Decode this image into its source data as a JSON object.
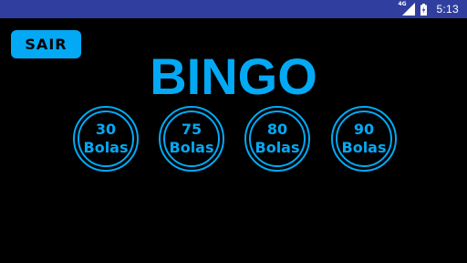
{
  "status_bar": {
    "network": "4G",
    "time": "5:13",
    "icons": [
      "signal-icon",
      "battery-charging-icon"
    ],
    "color": "#303f9f"
  },
  "exit_button": {
    "label": "SAIR",
    "color": "#03a9f4"
  },
  "title": "BINGO",
  "accent_color": "#03a9f4",
  "ball_options": [
    {
      "number": "30",
      "label": "Bolas"
    },
    {
      "number": "75",
      "label": "Bolas"
    },
    {
      "number": "80",
      "label": "Bolas"
    },
    {
      "number": "90",
      "label": "Bolas"
    }
  ]
}
